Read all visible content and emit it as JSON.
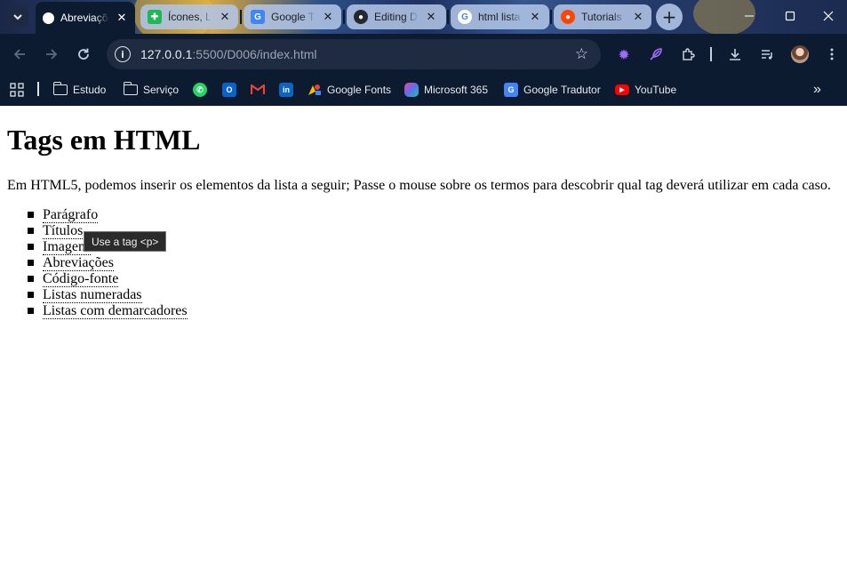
{
  "tabs": [
    {
      "title": "Abreviações",
      "active": true
    },
    {
      "title": "Ícones, L",
      "active": false
    },
    {
      "title": "Google T",
      "active": false
    },
    {
      "title": "Editing D",
      "active": false
    },
    {
      "title": "html lista",
      "active": false
    },
    {
      "title": "Tutorials",
      "active": false
    }
  ],
  "address": {
    "host": "127.0.0.1",
    "path": ":5500/D006/index.html"
  },
  "bookmarks": [
    {
      "label": "Estudo"
    },
    {
      "label": "Serviço"
    },
    {
      "label": "Google Fonts"
    },
    {
      "label": "Microsoft 365"
    },
    {
      "label": "Google Tradutor"
    },
    {
      "label": "YouTube"
    }
  ],
  "page": {
    "heading": "Tags em HTML",
    "intro": "Em HTML5, podemos inserir os elementos da lista a seguir; Passe o mouse sobre os termos para descobrir qual tag deverá utilizar em cada caso.",
    "items": [
      "Parágrafo",
      "Títulos",
      "Imagens",
      "Abreviações",
      "Código-fonte",
      "Listas numeradas",
      "Listas com demarcadores"
    ],
    "tooltip": "Use a tag <p>"
  },
  "colors": {
    "browser_bg": "#0d1b30",
    "tab_inactive": "#b0c4e6",
    "page_bg": "#ffffff"
  }
}
